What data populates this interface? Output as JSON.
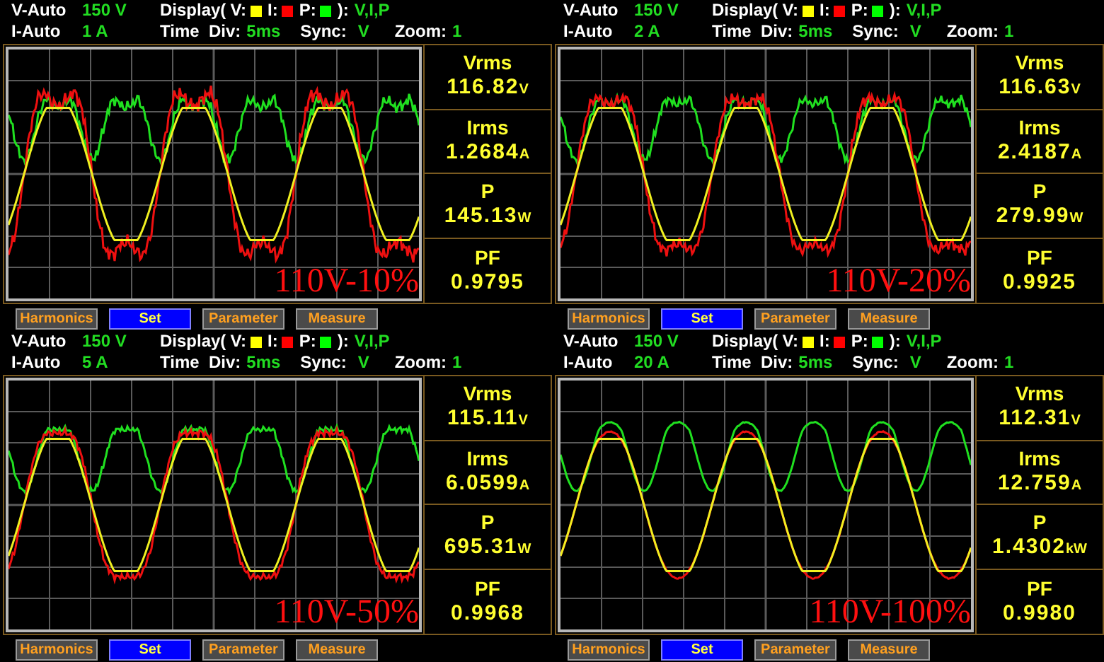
{
  "panels": [
    {
      "v_range": {
        "label": "V-Auto",
        "value": "150 V"
      },
      "i_range": {
        "label": "I-Auto",
        "value": "1 A"
      },
      "display": {
        "label": "Display(",
        "legend": [
          {
            "label": "V:",
            "color": "#ffff00"
          },
          {
            "label": "I:",
            "color": "#ff0000"
          },
          {
            "label": "P:",
            "color": "#00ff00"
          }
        ],
        "close": "):",
        "value": "V,I,P"
      },
      "time_div": {
        "label": "Time  Div:",
        "value": "5ms"
      },
      "sync": {
        "label": "Sync:",
        "value": "V"
      },
      "zoom": {
        "label": "Zoom:",
        "value": "1"
      },
      "caption": "110V-10%",
      "readings": [
        {
          "name": "Vrms",
          "value": "116.82",
          "unit": "V"
        },
        {
          "name": "Irms",
          "value": "1.2684",
          "unit": "A"
        },
        {
          "name": "P",
          "value": "145.13",
          "unit": "W"
        },
        {
          "name": "PF",
          "value": "0.9795"
        }
      ],
      "buttons": [
        {
          "label": "Harmonics",
          "selected": false
        },
        {
          "label": "Set",
          "selected": true
        },
        {
          "label": "Parameter",
          "selected": false
        },
        {
          "label": "Measure",
          "selected": false
        }
      ]
    },
    {
      "v_range": {
        "label": "V-Auto",
        "value": "150 V"
      },
      "i_range": {
        "label": "I-Auto",
        "value": "2 A"
      },
      "display": {
        "label": "Display(",
        "legend": [
          {
            "label": "V:",
            "color": "#ffff00"
          },
          {
            "label": "I:",
            "color": "#ff0000"
          },
          {
            "label": "P:",
            "color": "#00ff00"
          }
        ],
        "close": "):",
        "value": "V,I,P"
      },
      "time_div": {
        "label": "Time  Div:",
        "value": "5ms"
      },
      "sync": {
        "label": "Sync:",
        "value": "V"
      },
      "zoom": {
        "label": "Zoom:",
        "value": "1"
      },
      "caption": "110V-20%",
      "readings": [
        {
          "name": "Vrms",
          "value": "116.63",
          "unit": "V"
        },
        {
          "name": "Irms",
          "value": "2.4187",
          "unit": "A"
        },
        {
          "name": "P",
          "value": "279.99",
          "unit": "W"
        },
        {
          "name": "PF",
          "value": "0.9925"
        }
      ],
      "buttons": [
        {
          "label": "Harmonics",
          "selected": false
        },
        {
          "label": "Set",
          "selected": true
        },
        {
          "label": "Parameter",
          "selected": false
        },
        {
          "label": "Measure",
          "selected": false
        }
      ]
    },
    {
      "v_range": {
        "label": "V-Auto",
        "value": "150 V"
      },
      "i_range": {
        "label": "I-Auto",
        "value": "5 A"
      },
      "display": {
        "label": "Display(",
        "legend": [
          {
            "label": "V:",
            "color": "#ffff00"
          },
          {
            "label": "I:",
            "color": "#ff0000"
          },
          {
            "label": "P:",
            "color": "#00ff00"
          }
        ],
        "close": "):",
        "value": "V,I,P"
      },
      "time_div": {
        "label": "Time  Div:",
        "value": "5ms"
      },
      "sync": {
        "label": "Sync:",
        "value": "V"
      },
      "zoom": {
        "label": "Zoom:",
        "value": "1"
      },
      "caption": "110V-50%",
      "readings": [
        {
          "name": "Vrms",
          "value": "115.11",
          "unit": "V"
        },
        {
          "name": "Irms",
          "value": "6.0599",
          "unit": "A"
        },
        {
          "name": "P",
          "value": "695.31",
          "unit": "W"
        },
        {
          "name": "PF",
          "value": "0.9968"
        }
      ],
      "buttons": [
        {
          "label": "Harmonics",
          "selected": false
        },
        {
          "label": "Set",
          "selected": true
        },
        {
          "label": "Parameter",
          "selected": false
        },
        {
          "label": "Measure",
          "selected": false
        }
      ]
    },
    {
      "v_range": {
        "label": "V-Auto",
        "value": "150 V"
      },
      "i_range": {
        "label": "I-Auto",
        "value": "20 A"
      },
      "display": {
        "label": "Display(",
        "legend": [
          {
            "label": "V:",
            "color": "#ffff00"
          },
          {
            "label": "I:",
            "color": "#ff0000"
          },
          {
            "label": "P:",
            "color": "#00ff00"
          }
        ],
        "close": "):",
        "value": "V,I,P"
      },
      "time_div": {
        "label": "Time  Div:",
        "value": "5ms"
      },
      "sync": {
        "label": "Sync:",
        "value": "V"
      },
      "zoom": {
        "label": "Zoom:",
        "value": "1"
      },
      "caption": "110V-100%",
      "readings": [
        {
          "name": "Vrms",
          "value": "112.31",
          "unit": "V"
        },
        {
          "name": "Irms",
          "value": "12.759",
          "unit": "A"
        },
        {
          "name": "P",
          "value": "1.4302",
          "unit": "kW"
        },
        {
          "name": "PF",
          "value": "0.9980"
        }
      ],
      "buttons": [
        {
          "label": "Harmonics",
          "selected": false
        },
        {
          "label": "Set",
          "selected": true
        },
        {
          "label": "Parameter",
          "selected": false
        },
        {
          "label": "Measure",
          "selected": false
        }
      ]
    }
  ]
}
